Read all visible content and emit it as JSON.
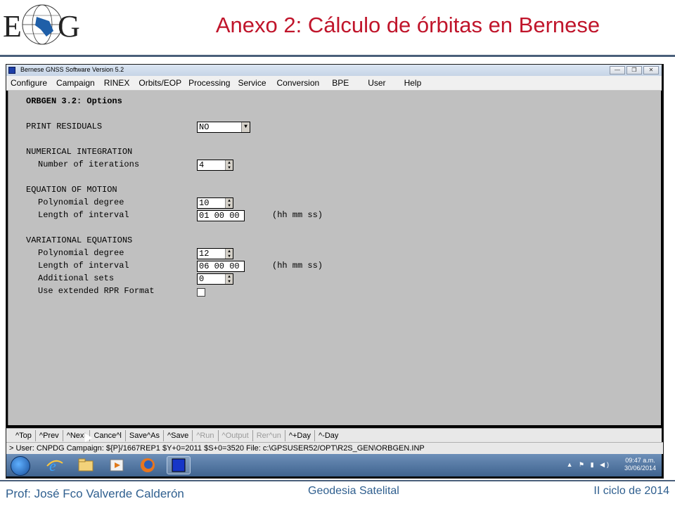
{
  "slide": {
    "title": "Anexo 2: Cálculo de órbitas en Bernese",
    "logo_text": "EFG",
    "footer_left": "Prof: José Fco Valverde Calderón",
    "footer_center": "Geodesia Satelital",
    "footer_right": "II ciclo de 2014"
  },
  "window": {
    "title": "Bernese GNSS Software Version 5.2",
    "menu": [
      "Configure",
      "Campaign",
      "RINEX",
      "Orbits/EOP",
      "Processing",
      "Service",
      "Conversion",
      "BPE",
      "User",
      "Help"
    ]
  },
  "panel": {
    "heading": "ORBGEN 3.2: Options",
    "print_residuals": {
      "label": "PRINT RESIDUALS",
      "value": "NO"
    },
    "numerical_integration": {
      "heading": "NUMERICAL INTEGRATION",
      "iterations_label": "Number of iterations",
      "iterations_value": "4"
    },
    "equation_of_motion": {
      "heading": "EQUATION OF MOTION",
      "poly_label": "Polynomial degree",
      "poly_value": "10",
      "interval_label": "Length of interval",
      "interval_value": "01 00 00",
      "interval_unit": "(hh mm ss)"
    },
    "variational_equations": {
      "heading": "VARIATIONAL EQUATIONS",
      "poly_label": "Polynomial degree",
      "poly_value": "12",
      "interval_label": "Length of interval",
      "interval_value": "06 00 00",
      "interval_unit": "(hh mm ss)",
      "sets_label": "Additional sets",
      "sets_value": "0",
      "rpr_label": "Use extended RPR Format",
      "rpr_checked": false
    }
  },
  "buttons": [
    {
      "label": "^Top",
      "enabled": true
    },
    {
      "label": "^Prev",
      "enabled": true
    },
    {
      "label": "^Next",
      "enabled": true
    },
    {
      "label": "Cance^l",
      "enabled": true
    },
    {
      "label": "Save^As",
      "enabled": true
    },
    {
      "label": "^Save",
      "enabled": true
    },
    {
      "label": "^Run",
      "enabled": false
    },
    {
      "label": "^Output",
      "enabled": false
    },
    {
      "label": "Rer^un",
      "enabled": false
    },
    {
      "label": "^+Day",
      "enabled": true
    },
    {
      "label": "^-Day",
      "enabled": true
    }
  ],
  "status": "> User: CNPDG  Campaign: ${P}/1667REP1  $Y+0=2011  $S+0=3520   File: c:\\GPSUSER52/OPT\\R2S_GEN\\ORBGEN.INP",
  "taskbar": {
    "time": "09:47 a.m.",
    "date": "30/06/2014",
    "apps": [
      "ie-icon",
      "explorer-icon",
      "media-player-icon",
      "firefox-icon",
      "bernese-icon"
    ]
  }
}
